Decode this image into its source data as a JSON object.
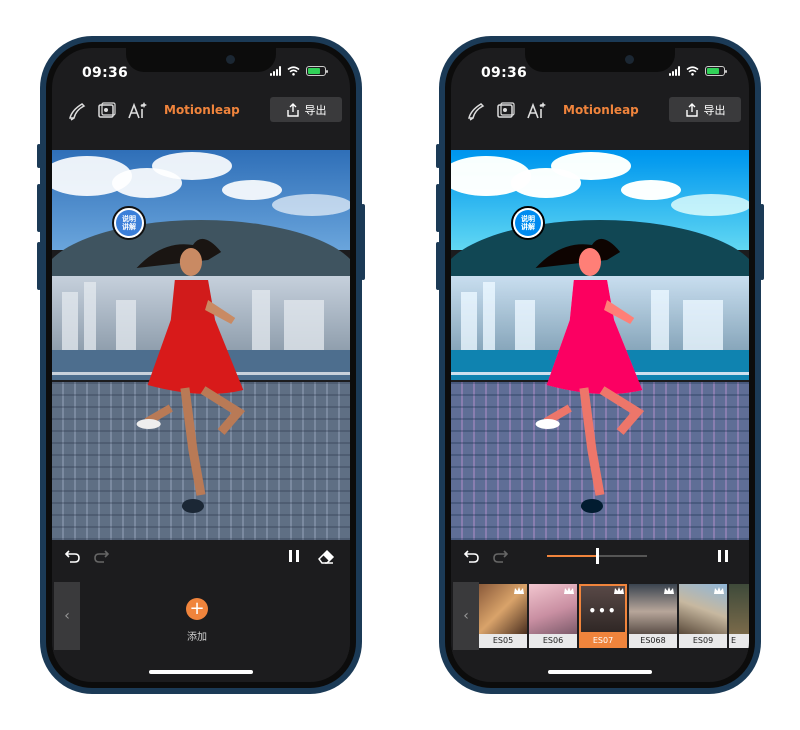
{
  "phones": [
    {
      "status_time": "09:36",
      "app_title": "Motionleap",
      "export_label": "导出",
      "badge_line1": "说明",
      "badge_line2": "讲解",
      "add_label": "添加",
      "icons": [
        "sky-icon",
        "image-layers-icon",
        "ai-icon",
        "share-icon",
        "undo-icon",
        "redo-icon",
        "pause-icon",
        "eraser-icon",
        "add-icon",
        "chevron-left-icon"
      ]
    },
    {
      "status_time": "09:36",
      "app_title": "Motionleap",
      "export_label": "导出",
      "badge_line1": "说明",
      "badge_line2": "讲解",
      "playback_progress": 0.5,
      "filters": [
        {
          "label": "ES05",
          "selected": false
        },
        {
          "label": "ES06",
          "selected": false
        },
        {
          "label": "ES07",
          "selected": true
        },
        {
          "label": "ES068",
          "selected": false
        },
        {
          "label": "ES09",
          "selected": false
        },
        {
          "label": "E",
          "selected": false
        }
      ],
      "selected_filter_menu": "•••",
      "icons": [
        "sky-icon",
        "image-layers-icon",
        "ai-icon",
        "share-icon",
        "undo-icon",
        "redo-icon",
        "pause-icon",
        "crown-icon",
        "chevron-left-icon"
      ]
    }
  ],
  "colors": {
    "accent": "#f0843c",
    "frame": "#1b3a56",
    "screen": "#1c1c1e"
  }
}
